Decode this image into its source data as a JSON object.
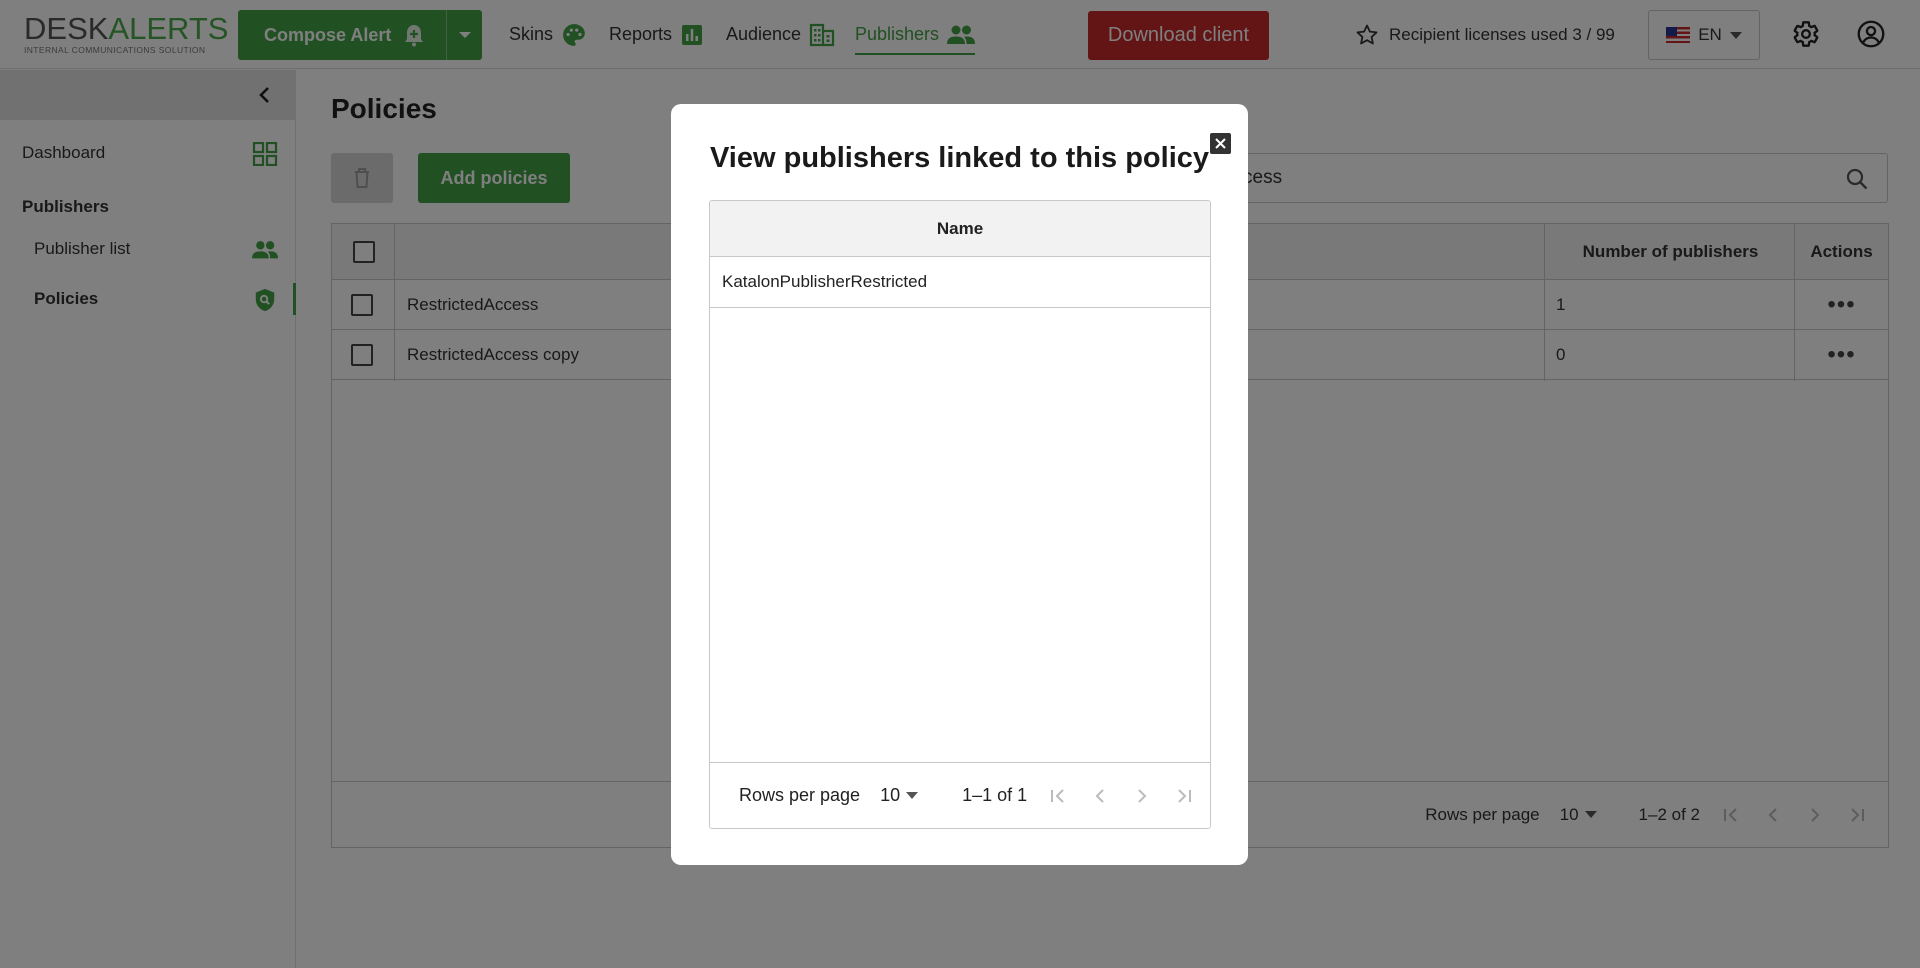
{
  "header": {
    "logo": {
      "main_a": "DESK",
      "main_b": "ALERTS",
      "sub": "INTERNAL COMMUNICATIONS SOLUTION"
    },
    "compose_label": "Compose Alert",
    "nav": [
      {
        "label": "Skins",
        "icon": "palette-icon"
      },
      {
        "label": "Reports",
        "icon": "bar-chart-icon"
      },
      {
        "label": "Audience",
        "icon": "building-icon"
      },
      {
        "label": "Publishers",
        "icon": "people-icon",
        "active": true
      }
    ],
    "download_label": "Download client",
    "licenses_text": "Recipient licenses used 3 / 99",
    "language": "EN"
  },
  "sidebar": {
    "dashboard": "Dashboard",
    "section": "Publishers",
    "items": [
      {
        "label": "Publisher list",
        "icon": "people-icon"
      },
      {
        "label": "Policies",
        "icon": "shield-search-icon",
        "active": true
      }
    ]
  },
  "main": {
    "title": "Policies",
    "add_label": "Add policies",
    "search_value_visible": "cess",
    "table": {
      "headers": {
        "name": "",
        "publishers": "Number of publishers",
        "actions": "Actions"
      },
      "rows": [
        {
          "name": "RestrictedAccess",
          "count": "1"
        },
        {
          "name": "RestrictedAccess copy",
          "count": "0"
        }
      ],
      "footer": {
        "rows_per_page_label": "Rows per page",
        "rows_per_page": "10",
        "range": "1–2 of 2"
      }
    }
  },
  "modal": {
    "title": "View publishers linked to this policy",
    "column": "Name",
    "rows": [
      "KatalonPublisherRestricted"
    ],
    "footer": {
      "rows_per_page_label": "Rows per page",
      "rows_per_page": "10",
      "range": "1–1 of 1"
    }
  },
  "colors": {
    "brand_green": "#43a047",
    "danger_red": "#c62828",
    "overlay": "rgba(0,0,0,0.5)"
  }
}
